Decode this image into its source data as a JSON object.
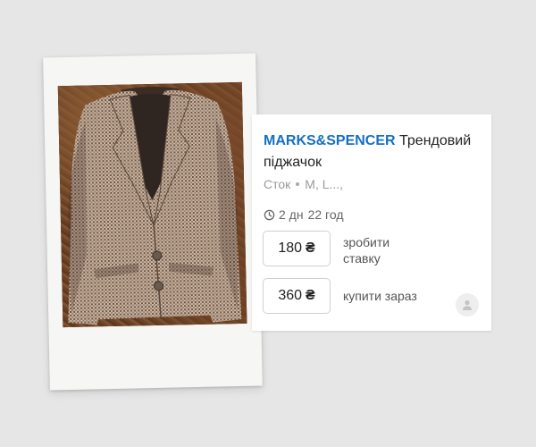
{
  "listing": {
    "brand": "MARKS&SPENCER",
    "title": "Трендовий піджачок",
    "condition": "Сток",
    "sizes": "M, L...,",
    "time_days": "2 дн",
    "time_hours": "22 год",
    "bid": {
      "price": "180",
      "currency": "₴",
      "label": "зробити ставку"
    },
    "buy_now": {
      "price": "360",
      "currency": "₴",
      "label": "купити зараз"
    }
  },
  "icons": {
    "timer": "clock-icon",
    "seller": "user-avatar-icon"
  },
  "colors": {
    "brand": "#1570c4",
    "background": "#e6e6e6"
  }
}
